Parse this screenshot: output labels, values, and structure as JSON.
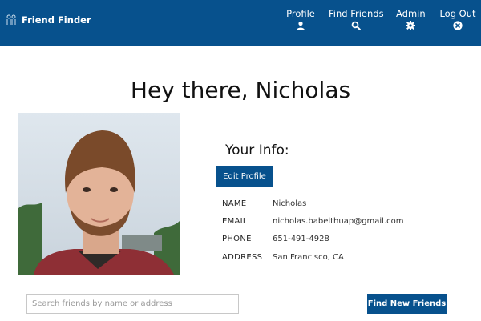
{
  "app": {
    "title": "Friend Finder"
  },
  "nav": {
    "profile": {
      "label": "Profile",
      "icon": "user-icon"
    },
    "find_friends": {
      "label": "Find Friends",
      "icon": "search-icon"
    },
    "admin": {
      "label": "Admin",
      "icon": "gear-icon"
    },
    "logout": {
      "label": "Log Out",
      "icon": "close-circle-icon"
    }
  },
  "greeting": "Hey there, Nicholas",
  "info": {
    "title": "Your Info:",
    "edit_label": "Edit Profile",
    "rows": [
      {
        "key": "NAME",
        "value": "Nicholas"
      },
      {
        "key": "EMAIL",
        "value": "nicholas.babelthuap@gmail.com"
      },
      {
        "key": "PHONE",
        "value": "651-491-4928"
      },
      {
        "key": "ADDRESS",
        "value": "San Francisco, CA"
      }
    ]
  },
  "search": {
    "placeholder": "Search friends by name or address",
    "value": "",
    "button_label": "Find New Friends"
  },
  "colors": {
    "brand": "#07518d",
    "background": "#ffffff"
  }
}
